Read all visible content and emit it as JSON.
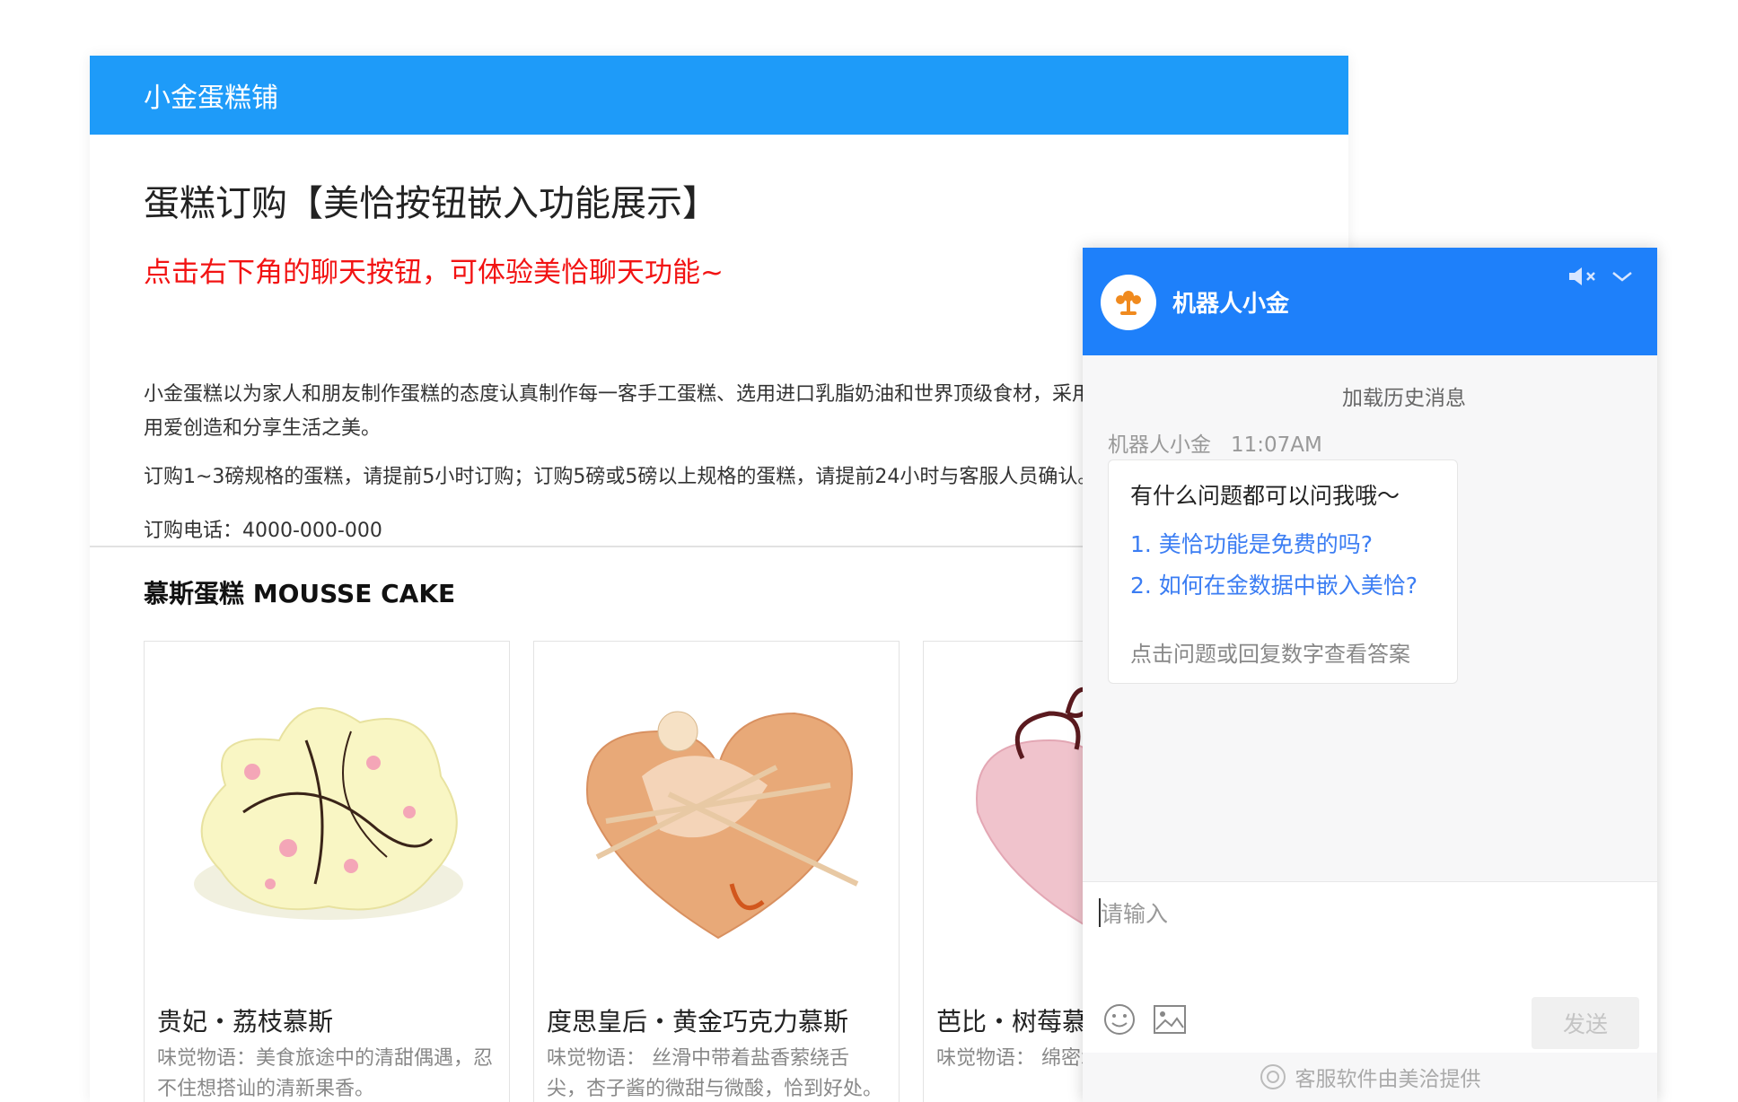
{
  "store": {
    "name": "小金蛋糕铺"
  },
  "info": {
    "title": "蛋糕订购【美恰按钮嵌入功能展示】",
    "hint": "点击右下角的聊天按钮，可体验美恰聊天功能~",
    "description": "小金蛋糕以为家人和朋友制作蛋糕的态度认真制作每一客手工蛋糕、选用进口乳脂奶油和世界顶级食材，采用绿色环保的包装，用心用爱创造和分享生活之美。",
    "order_rule": "订购1~3磅规格的蛋糕，请提前5小时订购；订购5磅或5磅以上规格的蛋糕，请提前24小时与客服人员确认。",
    "phone": "订购电话：4000-000-000"
  },
  "section": {
    "title": "慕斯蛋糕 MOUSSE CAKE"
  },
  "products": [
    {
      "name": "贵妃・荔枝慕斯",
      "desc": "味觉物语：美食旅途中的清甜偶遇，忍不住想搭讪的清新果香。"
    },
    {
      "name": "度思皇后・黄金巧克力慕斯",
      "desc": "味觉物语： 丝滑中带着盐香萦绕舌尖，杏子酱的微甜与微酸，恰到好处。"
    },
    {
      "name": "芭比・树莓慕斯",
      "desc": "味觉物语： 绵密水果的颗粒口感"
    }
  ],
  "chat": {
    "bot_name": "机器人小金",
    "load_history": "加载历史消息",
    "sender": "机器人小金",
    "time": "11:07AM",
    "greeting": "有什么问题都可以问我哦～",
    "questions": [
      "1. 美恰功能是免费的吗?",
      "2. 如何在金数据中嵌入美恰?"
    ],
    "tip": "点击问题或回复数字查看答案",
    "input_placeholder": "请输入",
    "send_label": "发送",
    "footer": "客服软件由美洽提供"
  },
  "colors": {
    "header": "#1e9bf9",
    "chat_header": "#1e80fa",
    "hint": "#f21313",
    "link": "#3b7df3"
  }
}
